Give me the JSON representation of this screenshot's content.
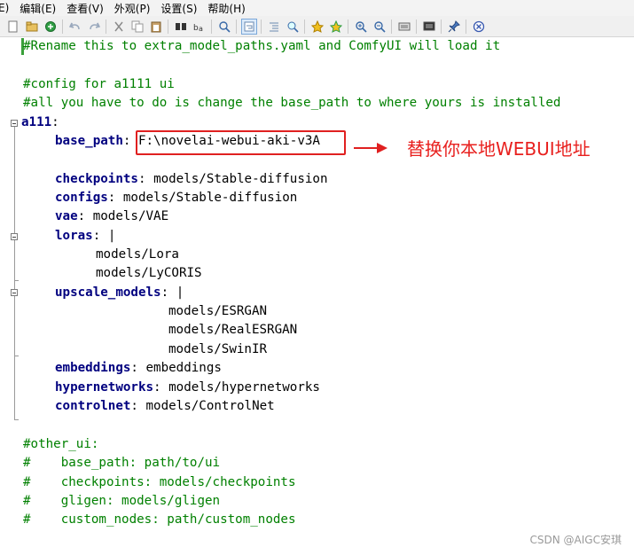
{
  "menu": [
    "E)",
    "编辑(E)",
    "查看(V)",
    "外观(P)",
    "设置(S)",
    "帮助(H)"
  ],
  "toolbar": {
    "icons": [
      "new-file-icon",
      "open-folder-icon",
      "save-icon",
      "undo-icon",
      "redo-icon",
      "cut-icon",
      "copy-icon",
      "paste-icon",
      "find-icon",
      "replace-icon",
      "find-in-files-icon",
      "word-wrap-icon",
      "indent-icon",
      "zoom-find-icon",
      "bookmark-icon",
      "bookmark-all-icon",
      "zoom-in-icon",
      "zoom-out-icon",
      "panel-icon",
      "monitor-icon",
      "pin-icon",
      "close-icon"
    ]
  },
  "editor": {
    "lines": {
      "l1": "#Rename this to extra_model_paths.yaml and ComfyUI will load it",
      "l3": "#config for a1111 ui",
      "l4": "#all you have to do is change the base_path to where yours is installed",
      "l5_key": "a111",
      "l5_colon": ":",
      "l6_key": "base_path",
      "l6_val": "F:\\novelai-webui-aki-v3A",
      "l8_key": "checkpoints",
      "l8_val": "models/Stable-diffusion",
      "l9_key": "configs",
      "l9_val": "models/Stable-diffusion",
      "l10_key": "vae",
      "l10_val": "models/VAE",
      "l11_key": "loras",
      "l11_val": "|",
      "l12": "models/Lora",
      "l13": "models/LyCORIS",
      "l14_key": "upscale_models",
      "l14_val": "|",
      "l15": "models/ESRGAN",
      "l16": "models/RealESRGAN",
      "l17": "models/SwinIR",
      "l18_key": "embeddings",
      "l18_val": "embeddings",
      "l19_key": "hypernetworks",
      "l19_val": "models/hypernetworks",
      "l20_key": "controlnet",
      "l20_val": "models/ControlNet",
      "l22": "#other_ui:",
      "l23": "#    base_path: path/to/ui",
      "l24": "#    checkpoints: models/checkpoints",
      "l25": "#    gligen: models/gligen",
      "l26": "#    custom_nodes: path/custom_nodes"
    }
  },
  "annotation": {
    "text": "替换你本地WEBUI地址",
    "color": "#e8201e"
  },
  "watermark": "CSDN @AIGC安琪",
  "colors": {
    "comment": "#008000",
    "key": "#00007f",
    "highlight": "#e02020"
  }
}
